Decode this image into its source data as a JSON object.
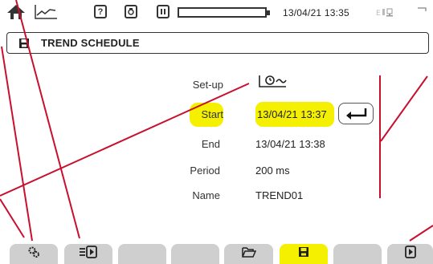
{
  "status_bar": {
    "icons": [
      "home-icon",
      "trend-icon",
      "help-icon",
      "camera-icon",
      "pause-icon",
      "battery-icon",
      "network-icon"
    ],
    "datetime": "13/04/21 13:35"
  },
  "title": "TREND SCHEDULE",
  "form": {
    "setup_label": "Set-up",
    "start_label": "Start",
    "start_value": "13/04/21 13:37",
    "end_label": "End",
    "end_value": "13/04/21 13:38",
    "period_label": "Period",
    "period_value": "200 ms",
    "name_label": "Name",
    "name_value": "TREND01"
  },
  "toolbar": {
    "buttons": [
      {
        "name": "settings-button",
        "icon": "gears-icon"
      },
      {
        "name": "trend-record-button",
        "icon": "list-play-icon"
      },
      {
        "name": "empty-button-3",
        "icon": ""
      },
      {
        "name": "empty-button-4",
        "icon": ""
      },
      {
        "name": "empty-button-5",
        "icon": ""
      },
      {
        "name": "open-folder-button",
        "icon": "folder-open-icon"
      },
      {
        "name": "save-button",
        "icon": "floppy-disk-icon",
        "active": true
      },
      {
        "name": "empty-button-8",
        "icon": ""
      },
      {
        "name": "start-button",
        "icon": "play-icon"
      }
    ]
  },
  "colors": {
    "highlight": "#f4f000",
    "annotation": "#c8102e",
    "tab": "#cfcfcf"
  }
}
